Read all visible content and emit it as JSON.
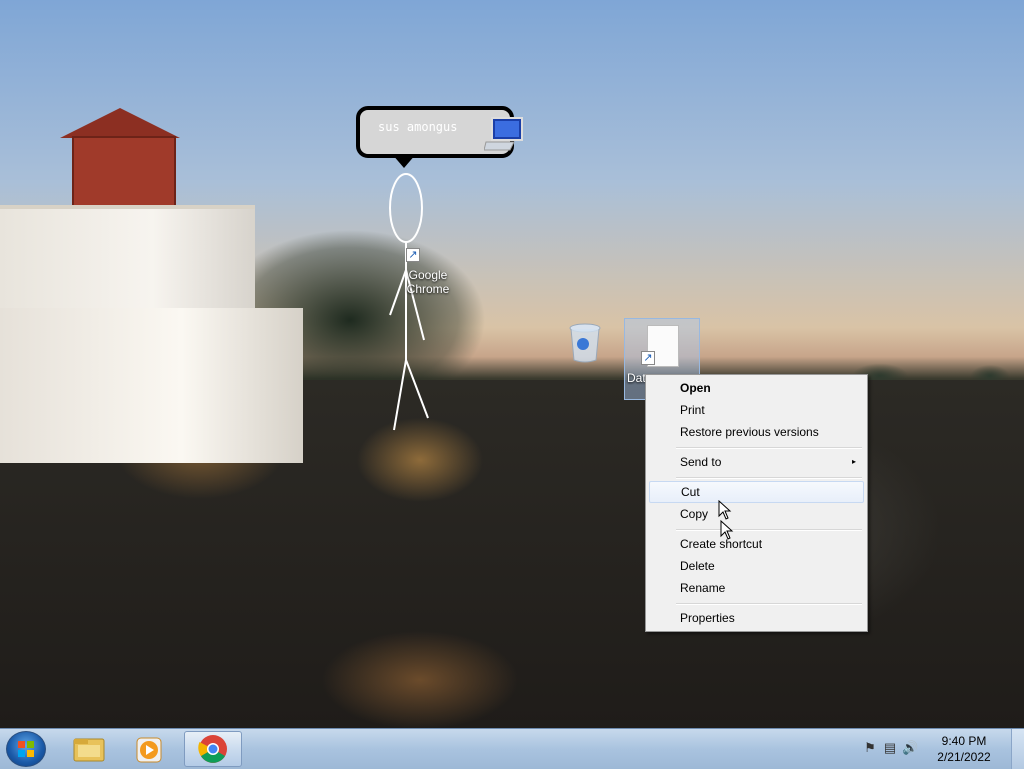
{
  "desktop": {
    "speech_bubble_text": "sus amongus",
    "icons": {
      "chrome": {
        "label": "Google Chrome",
        "icon": "chrome-shortcut-icon"
      },
      "recycle_bin": {
        "icon": "recycle-bin-icon"
      },
      "computer": {
        "icon": "computer-icon"
      },
      "selected_file": {
        "label": "Dat",
        "icon": "file-shortcut-icon"
      }
    }
  },
  "context_menu": {
    "items": [
      {
        "label": "Open",
        "bold": true
      },
      {
        "label": "Print"
      },
      {
        "label": "Restore previous versions"
      },
      {
        "label": "Send to",
        "submenu_arrow": "▸"
      },
      {
        "label": "Cut"
      },
      {
        "label": "Copy"
      },
      {
        "label": "Create shortcut"
      },
      {
        "label": "Delete"
      },
      {
        "label": "Rename"
      },
      {
        "label": "Properties"
      }
    ]
  },
  "taskbar": {
    "start_icon": "windows-start-icon",
    "pinned": [
      "explorer-icon",
      "media-player-icon",
      "chrome-icon"
    ],
    "tray": {
      "icons": [
        "action-center-flag-icon",
        "network-icon",
        "volume-icon"
      ],
      "time": "9:40 PM",
      "date": "2/21/2022"
    }
  }
}
